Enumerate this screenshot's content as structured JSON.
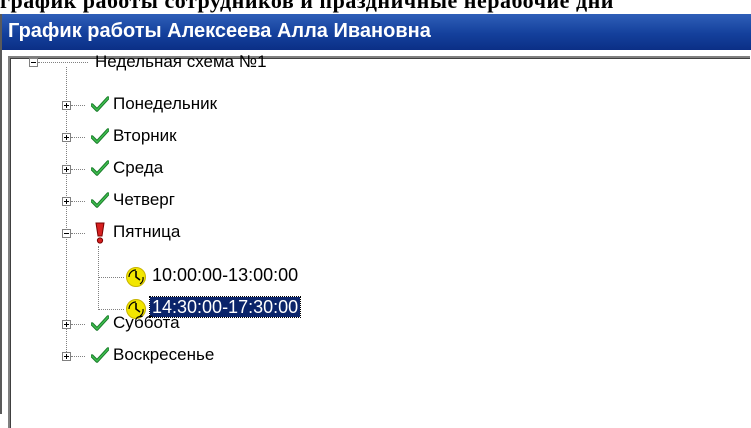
{
  "window": {
    "title": "График работы Алексеева Алла Ивановна",
    "clipped_heading": "график работы сотрудников и праздничные нерабочие дни"
  },
  "tree": {
    "root": {
      "label": "Недельная схема №1",
      "expanded": true
    },
    "days": [
      {
        "label": "Понедельник",
        "status": "ok",
        "expanded": false
      },
      {
        "label": "Вторник",
        "status": "ok",
        "expanded": false
      },
      {
        "label": "Среда",
        "status": "ok",
        "expanded": false
      },
      {
        "label": "Четверг",
        "status": "ok",
        "expanded": false
      },
      {
        "label": "Пятница",
        "status": "warning",
        "expanded": true,
        "intervals": [
          {
            "label": "10:00:00-13:00:00",
            "selected": false
          },
          {
            "label": "14:30:00-17:30:00",
            "selected": true
          }
        ]
      },
      {
        "label": "Суббота",
        "status": "ok",
        "expanded": false
      },
      {
        "label": "Воскресенье",
        "status": "ok",
        "expanded": false
      }
    ]
  },
  "colors": {
    "title_bar": "#14409c",
    "selection": "#0a246a",
    "check": "#1a7a2a",
    "warning": "#d62020",
    "clock": "#f2e600"
  },
  "icons": {
    "ok": "check-icon",
    "warning": "exclamation-icon",
    "interval": "clock-icon"
  }
}
